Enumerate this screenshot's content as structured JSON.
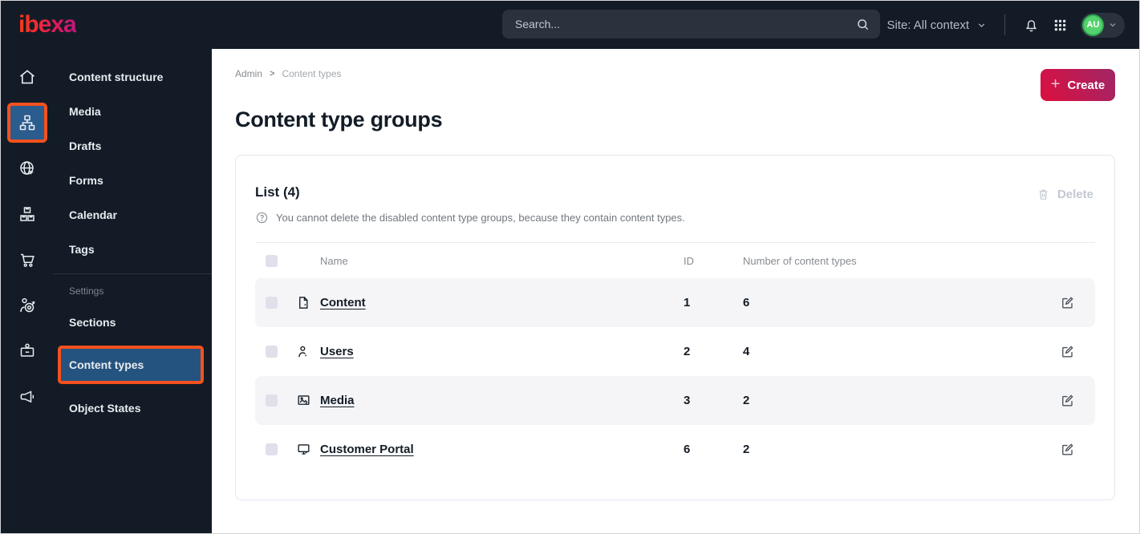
{
  "topbar": {
    "logo": "ibexa",
    "search": {
      "placeholder": "Search..."
    },
    "site": {
      "label": "Site: All context"
    },
    "avatar": {
      "initials": "AU"
    },
    "icons": [
      "globe-icon",
      "chevron-down-icon",
      "bell-icon",
      "app-grid-icon"
    ]
  },
  "icon_rail": {
    "items": [
      {
        "icon": "home-icon",
        "active": false
      },
      {
        "icon": "content-structure-icon",
        "active": true,
        "annotated": true
      },
      {
        "icon": "site-globe-icon",
        "active": false
      },
      {
        "icon": "product-boxes-icon",
        "active": false
      },
      {
        "icon": "commerce-cart-icon",
        "active": false
      },
      {
        "icon": "personalization-target-icon",
        "active": false
      },
      {
        "icon": "admin-badge-icon",
        "active": false
      },
      {
        "icon": "marketing-megaphone-icon",
        "active": false
      }
    ]
  },
  "sidebar": {
    "items": [
      "Content structure",
      "Media",
      "Drafts",
      "Forms",
      "Calendar",
      "Tags"
    ],
    "settings_label": "Settings",
    "settings_items": [
      "Sections",
      "Content types",
      "Object States"
    ],
    "active_item": "Content types"
  },
  "breadcrumb": {
    "items": [
      "Admin",
      "Content types"
    ],
    "separator": ">"
  },
  "page": {
    "title": "Content type groups",
    "create_label": "Create",
    "create_plus": "+"
  },
  "list_card": {
    "title": "List (4)",
    "info": "You cannot delete the disabled content type groups, because they contain content types.",
    "delete_label": "Delete",
    "table": {
      "columns": [
        "Name",
        "ID",
        "Number of content types"
      ],
      "rows": [
        {
          "icon": "file-icon",
          "name": "Content",
          "id": "1",
          "count": "6"
        },
        {
          "icon": "user-icon",
          "name": "Users",
          "id": "2",
          "count": "4"
        },
        {
          "icon": "image-icon",
          "name": "Media",
          "id": "3",
          "count": "2"
        },
        {
          "icon": "monitor-icon",
          "name": "Customer Portal",
          "id": "6",
          "count": "2"
        }
      ]
    }
  },
  "colors": {
    "dark_bg": "#131c26",
    "active_blue": "#25537f",
    "annotation_orange": "#f4511e",
    "create_gradient_start": "#dc0f3f",
    "create_gradient_end": "#a02666",
    "avatar_green": "#55d16e",
    "row_stripe": "#f5f5f8"
  }
}
